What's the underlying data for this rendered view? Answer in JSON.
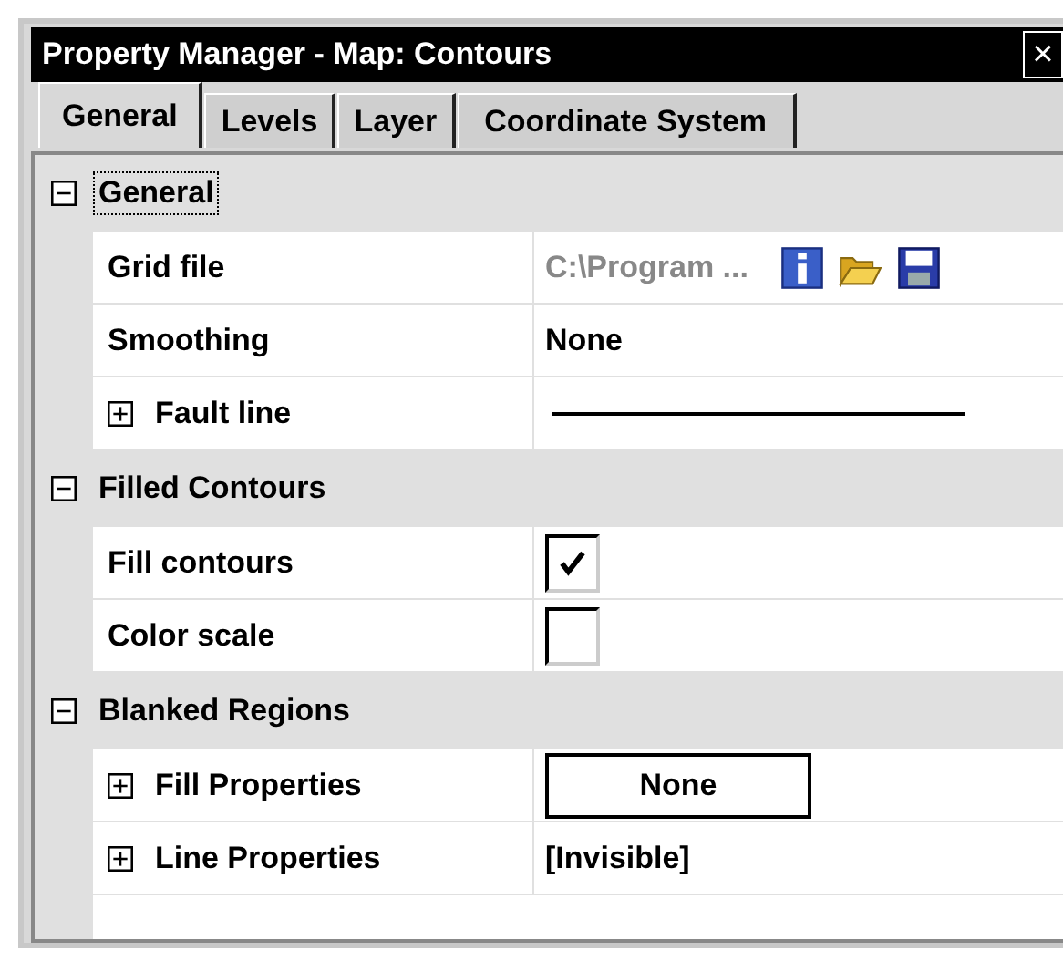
{
  "window": {
    "title": "Property Manager - Map: Contours",
    "close": "×"
  },
  "tabs": [
    {
      "label": "General",
      "selected": true
    },
    {
      "label": "Levels",
      "selected": false
    },
    {
      "label": "Layer",
      "selected": false
    },
    {
      "label": "Coordinate System",
      "selected": false
    }
  ],
  "groups": [
    {
      "name": "General",
      "expanded": true,
      "focused": true,
      "properties": [
        {
          "name": "Grid file",
          "kind": "file",
          "value": "C:\\Program ..."
        },
        {
          "name": "Smoothing",
          "kind": "text",
          "value": "None"
        },
        {
          "name": "Fault line",
          "kind": "line",
          "expanded": false
        }
      ]
    },
    {
      "name": "Filled Contours",
      "expanded": true,
      "focused": false,
      "properties": [
        {
          "name": "Fill contours",
          "kind": "checkbox",
          "checked": true
        },
        {
          "name": "Color scale",
          "kind": "checkbox",
          "checked": false
        }
      ]
    },
    {
      "name": "Blanked Regions",
      "expanded": true,
      "focused": false,
      "properties": [
        {
          "name": "Fill Properties",
          "kind": "button",
          "value": "None",
          "expanded": false
        },
        {
          "name": "Line Properties",
          "kind": "text",
          "value": "[Invisible]",
          "expanded": false
        }
      ]
    }
  ]
}
